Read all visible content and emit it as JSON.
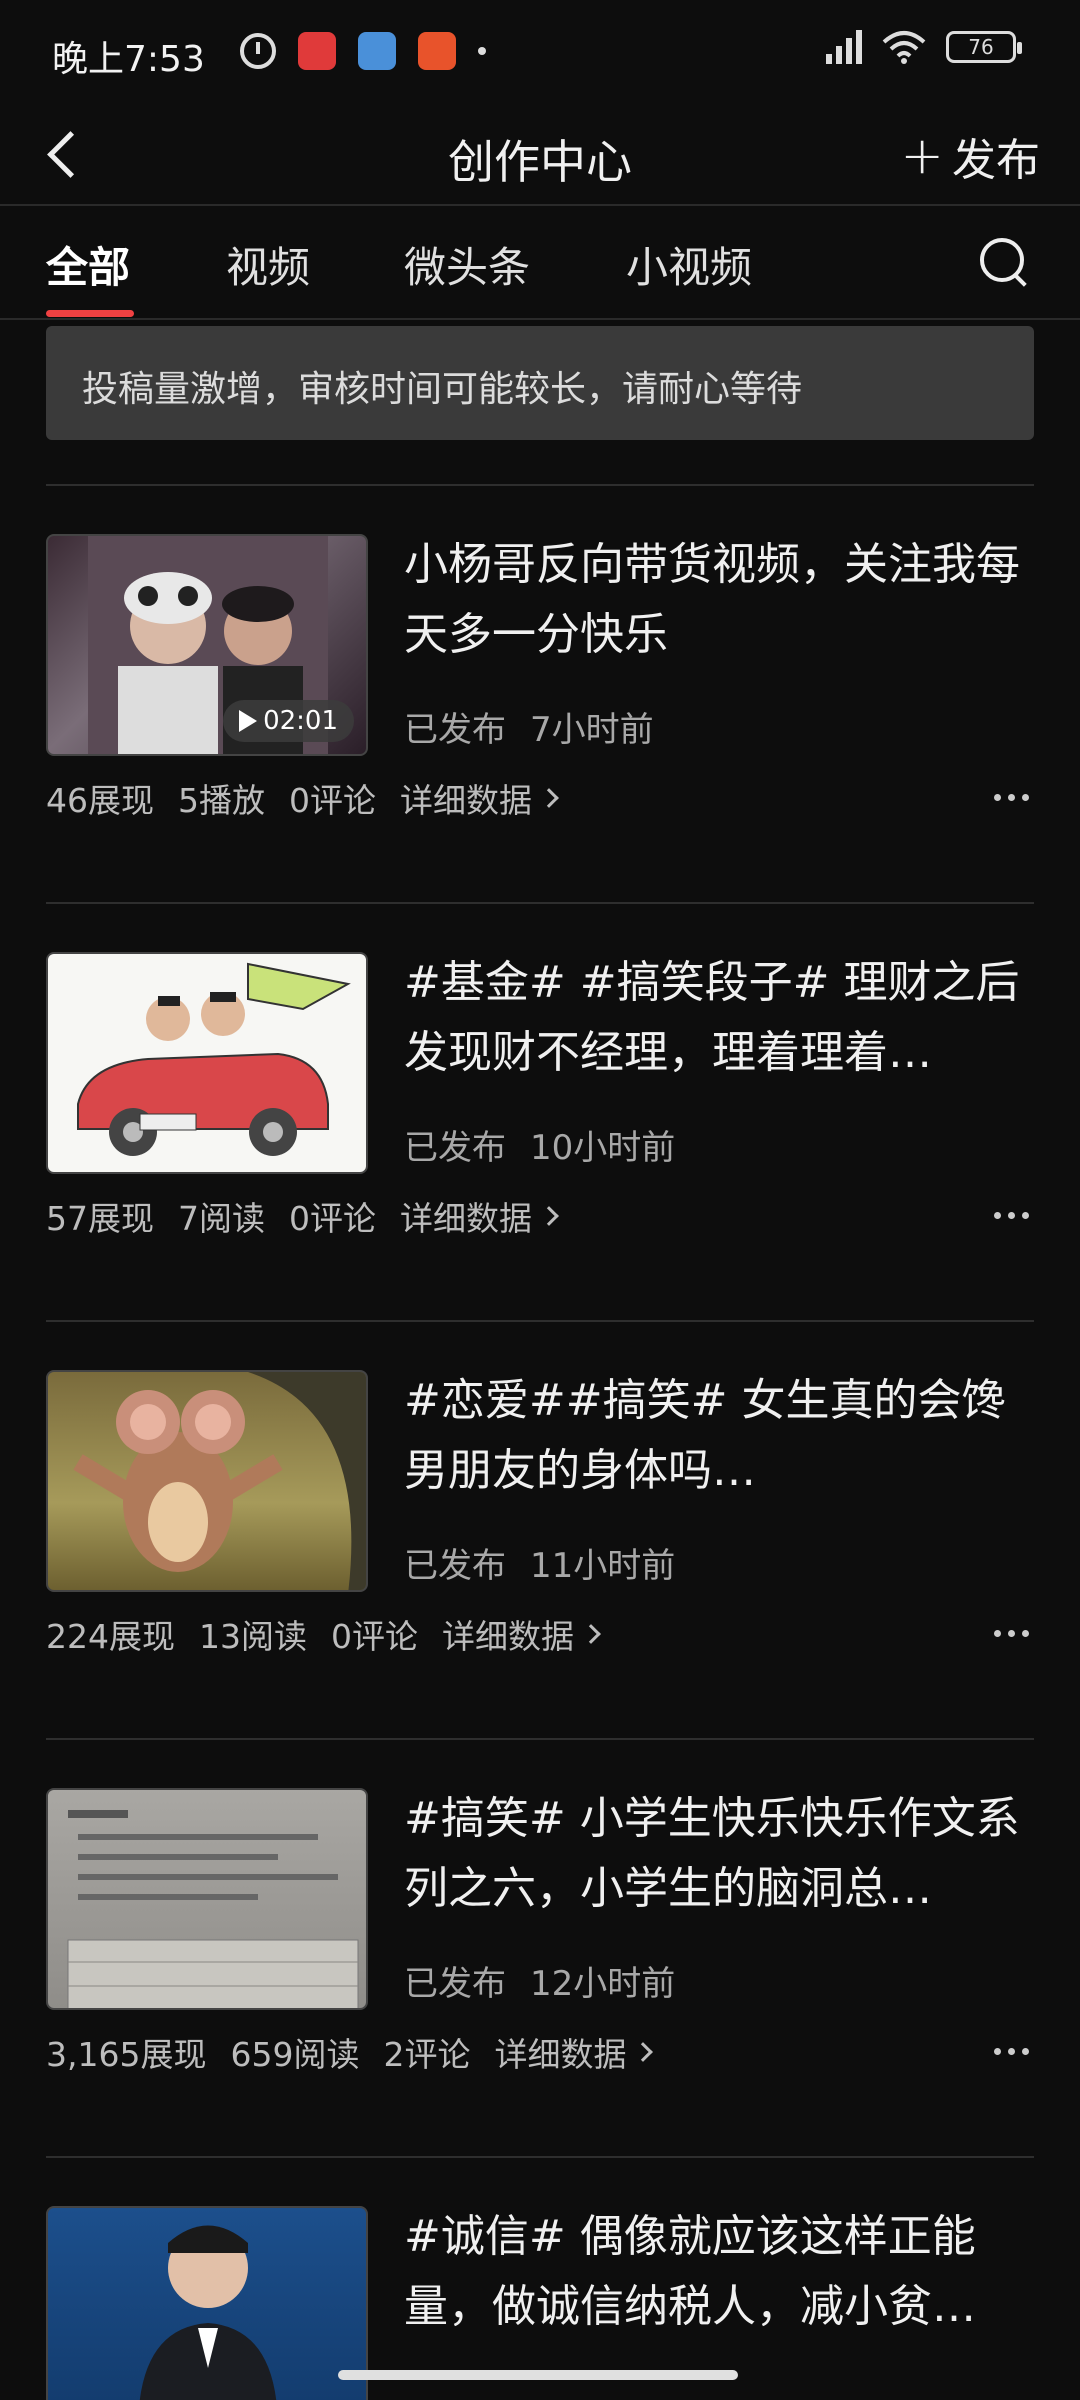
{
  "status_bar": {
    "time": "晚上7:53",
    "battery": "76"
  },
  "nav": {
    "title": "创作中心",
    "publish_label": "发布"
  },
  "tabs": [
    {
      "label": "全部",
      "active": true
    },
    {
      "label": "视频",
      "active": false
    },
    {
      "label": "微头条",
      "active": false
    },
    {
      "label": "小视频",
      "active": false
    }
  ],
  "notice": "投稿量激增，审核时间可能较长，请耐心等待",
  "posts": [
    {
      "title": "小杨哥反向带货视频，关注我每天多一分快乐",
      "status": "已发布",
      "time": "7小时前",
      "duration": "02:01",
      "stats": [
        "46展现",
        "5播放",
        "0评论"
      ],
      "detail": "详细数据"
    },
    {
      "title": "#基金# #搞笑段子# 理财之后发现财不经理，理着理着…",
      "status": "已发布",
      "time": "10小时前",
      "stats": [
        "57展现",
        "7阅读",
        "0评论"
      ],
      "detail": "详细数据"
    },
    {
      "title": "#恋爱##搞笑# 女生真的会馋男朋友的身体吗…",
      "status": "已发布",
      "time": "11小时前",
      "stats": [
        "224展现",
        "13阅读",
        "0评论"
      ],
      "detail": "详细数据"
    },
    {
      "title": "#搞笑# 小学生快乐快乐作文系列之六，小学生的脑洞总…",
      "status": "已发布",
      "time": "12小时前",
      "stats": [
        "3,165展现",
        "659阅读",
        "2评论"
      ],
      "detail": "详细数据"
    },
    {
      "title": "#诚信# 偶像就应该这样正能量，做诚信纳税人，减小贫…",
      "status": "",
      "time": "",
      "stats": [],
      "detail": ""
    }
  ]
}
